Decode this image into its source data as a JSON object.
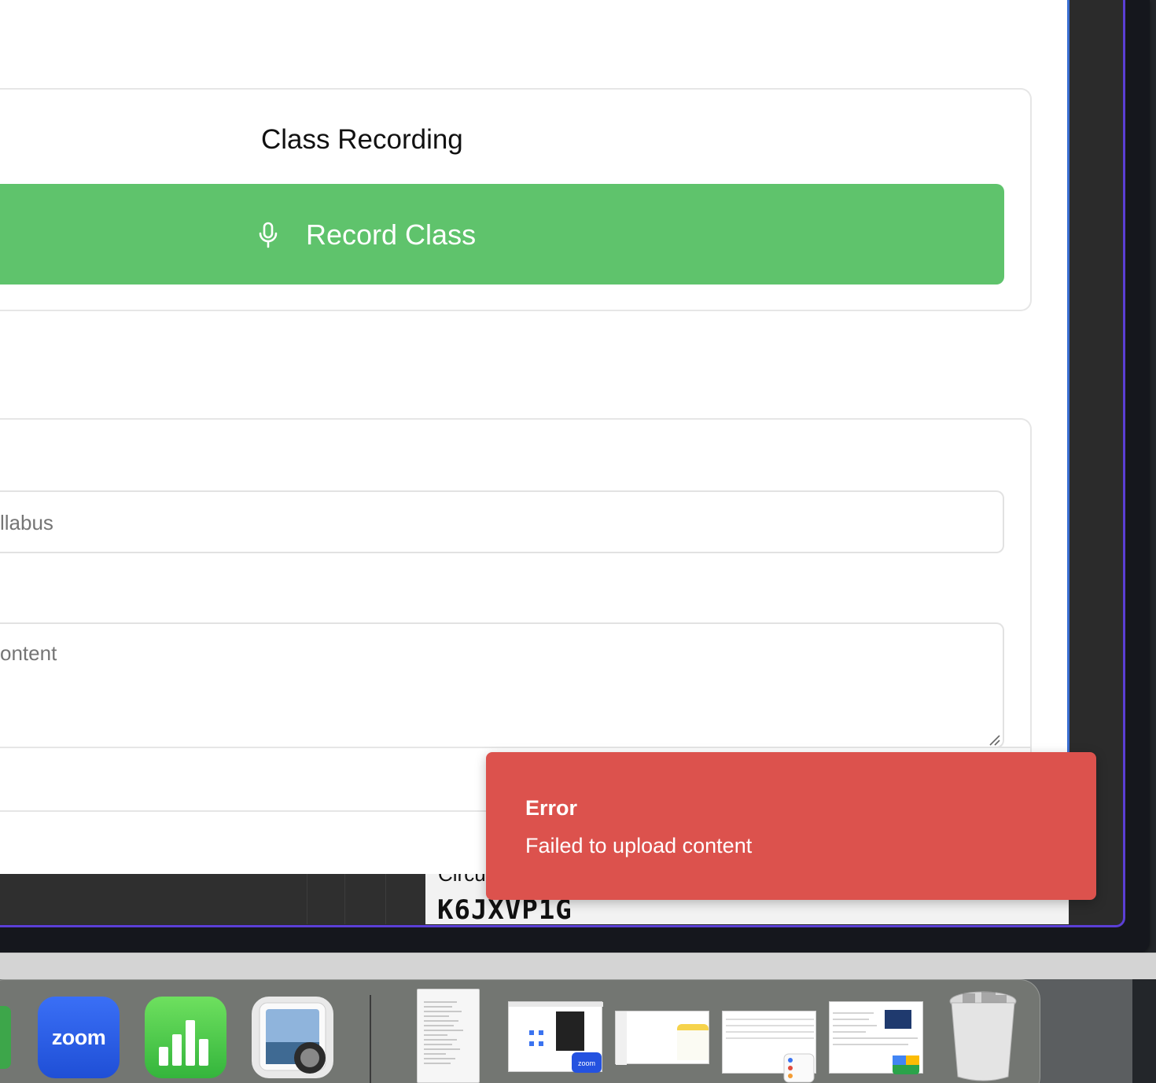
{
  "recording_card": {
    "title": "Class Recording",
    "record_button_label": "Record Class"
  },
  "content_card": {
    "syllabus_placeholder": "llabus",
    "content_placeholder": "ontent"
  },
  "background_window": {
    "label_fragment": "Circu",
    "code": "K6JXVP1G"
  },
  "toast": {
    "title": "Error",
    "message": "Failed to upload content",
    "color": "#dc524d"
  },
  "dock": {
    "zoom_label": "zoom",
    "zoom_badge": "zoom",
    "items": [
      "zoom-app",
      "numbers-app",
      "preview-app",
      "document-stack",
      "zoom-window",
      "notes-window",
      "reminders-window",
      "chat-window",
      "trash"
    ]
  },
  "colors": {
    "record_green": "#5fc36c",
    "frame_purple": "#5b3fd6",
    "page_border_blue": "#3b6fd1"
  }
}
